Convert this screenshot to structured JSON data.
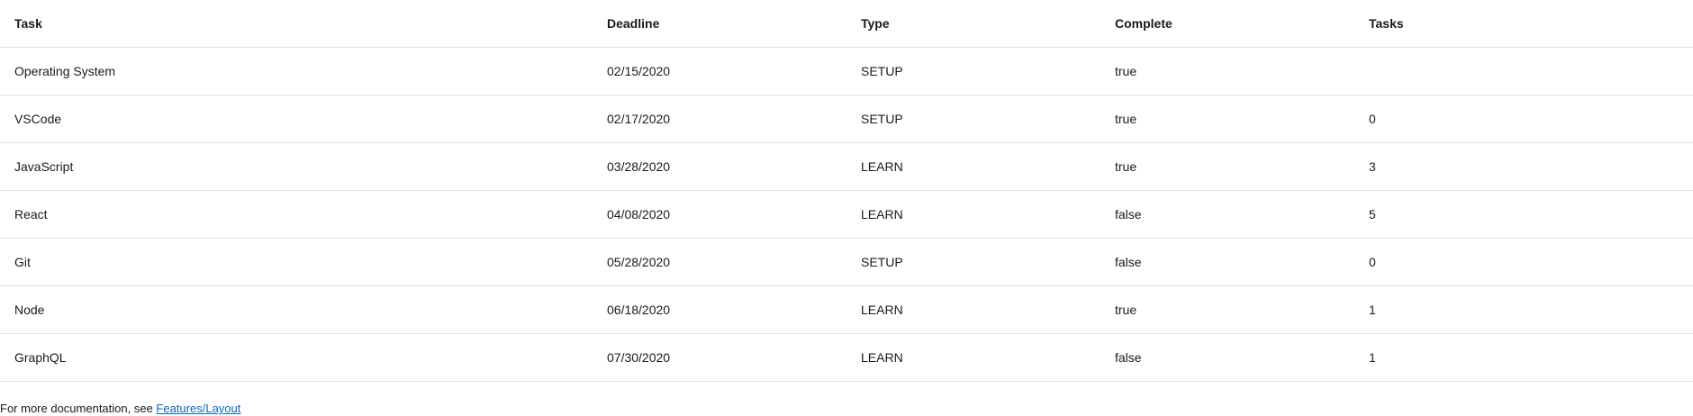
{
  "table": {
    "headers": [
      "Task",
      "Deadline",
      "Type",
      "Complete",
      "Tasks"
    ],
    "rows": [
      [
        "Operating System",
        "02/15/2020",
        "SETUP",
        "true",
        ""
      ],
      [
        "VSCode",
        "02/17/2020",
        "SETUP",
        "true",
        "0"
      ],
      [
        "JavaScript",
        "03/28/2020",
        "LEARN",
        "true",
        "3"
      ],
      [
        "React",
        "04/08/2020",
        "LEARN",
        "false",
        "5"
      ],
      [
        "Git",
        "05/28/2020",
        "SETUP",
        "false",
        "0"
      ],
      [
        "Node",
        "06/18/2020",
        "LEARN",
        "true",
        "1"
      ],
      [
        "GraphQL",
        "07/30/2020",
        "LEARN",
        "false",
        "1"
      ]
    ]
  },
  "footer": {
    "text": "For more documentation, see ",
    "link_label": "Features/Layout"
  }
}
